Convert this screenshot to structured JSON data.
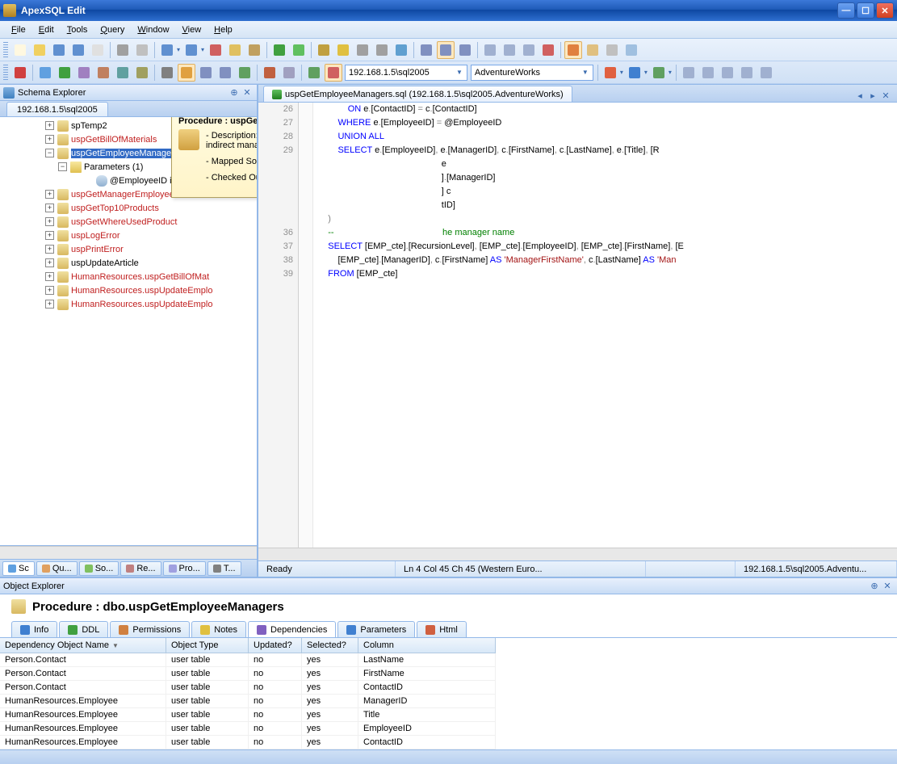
{
  "window": {
    "title": "ApexSQL Edit"
  },
  "menu": [
    "File",
    "Edit",
    "Tools",
    "Query",
    "Window",
    "View",
    "Help"
  ],
  "combos": {
    "server": "192.168.1.5\\sql2005",
    "database": "AdventureWorks"
  },
  "schemaExplorer": {
    "title": "Schema Explorer",
    "currentTab": "192.168.1.5\\sql2005",
    "nodes": [
      {
        "ind": 56,
        "exp": "+",
        "icon": "proc",
        "label": "spTemp2"
      },
      {
        "ind": 56,
        "exp": "+",
        "icon": "proc",
        "label": "uspGetBillOfMaterials",
        "red": true
      },
      {
        "ind": 56,
        "exp": "−",
        "icon": "proc",
        "label": "uspGetEmployeeManagers",
        "sel": true
      },
      {
        "ind": 72,
        "exp": "−",
        "icon": "folder",
        "label": "Parameters (1)"
      },
      {
        "ind": 104,
        "noexp": true,
        "icon": "param",
        "label": "@EmployeeID int"
      },
      {
        "ind": 56,
        "exp": "+",
        "icon": "proc",
        "label": "uspGetManagerEmployees",
        "red": true
      },
      {
        "ind": 56,
        "exp": "+",
        "icon": "proc",
        "label": "uspGetTop10Products",
        "red": true
      },
      {
        "ind": 56,
        "exp": "+",
        "icon": "proc",
        "label": "uspGetWhereUsedProduct",
        "red": true
      },
      {
        "ind": 56,
        "exp": "+",
        "icon": "proc",
        "label": "uspLogError",
        "red": true
      },
      {
        "ind": 56,
        "exp": "+",
        "icon": "proc",
        "label": "uspPrintError",
        "red": true
      },
      {
        "ind": 56,
        "exp": "+",
        "icon": "proc",
        "label": "uspUpdateArticle"
      },
      {
        "ind": 56,
        "exp": "+",
        "icon": "proc",
        "label": "HumanResources.uspGetBillOfMat",
        "red": true
      },
      {
        "ind": 56,
        "exp": "+",
        "icon": "proc",
        "label": "HumanResources.uspUpdateEmplo",
        "red": true
      },
      {
        "ind": 56,
        "exp": "+",
        "icon": "proc",
        "label": "HumanResources.uspUpdateEmplo",
        "red": true
      }
    ],
    "viewtabs": [
      {
        "label": "Sc",
        "color": "#60a0e0",
        "active": true
      },
      {
        "label": "Qu...",
        "color": "#e0a060"
      },
      {
        "label": "So...",
        "color": "#80c060"
      },
      {
        "label": "Re...",
        "color": "#c08080"
      },
      {
        "label": "Pro...",
        "color": "#a0a0e0"
      },
      {
        "label": "T...",
        "color": "#808080"
      }
    ]
  },
  "editor": {
    "tabTitle": "uspGetEmployeeManagers.sql (192.168.1.5\\sql2005.AdventureWorks)",
    "firstLine": 26,
    "lines": [
      {
        "html": "            <span class='kw'>ON</span> e<span class='gy'>.</span>[ContactID] <span class='gy'>=</span> c<span class='gy'>.</span>[ContactID]"
      },
      {
        "html": "        <span class='kw'>WHERE</span> e<span class='gy'>.</span>[EmployeeID] <span class='gy'>=</span> @EmployeeID"
      },
      {
        "html": "        <span class='kw'>UNION</span> <span class='kw'>ALL</span>"
      },
      {
        "html": "        <span class='kw'>SELECT</span> e<span class='gy'>.</span>[EmployeeID]<span class='gy'>,</span> e<span class='gy'>.</span>[ManagerID]<span class='gy'>,</span> c<span class='gy'>.</span>[FirstName]<span class='gy'>,</span> c<span class='gy'>.</span>[LastName]<span class='gy'>,</span> e<span class='gy'>.</span>[Title]<span class='gy'>,</span> [R"
      },
      {
        "html": "                                                  e"
      },
      {
        "html": "                                                  ]<span class='gy'>.</span>[ManagerID]"
      },
      {
        "html": "                                                  ] c"
      },
      {
        "html": "                                                  tID]"
      },
      {
        "html": "    <span class='gy'>)</span>"
      },
      {
        "html": "    <span class='cm'>--                                            he manager name</span>"
      },
      {
        "html": "    <span class='kw'>SELECT</span> [EMP_cte]<span class='gy'>.</span>[RecursionLevel]<span class='gy'>,</span> [EMP_cte]<span class='gy'>.</span>[EmployeeID]<span class='gy'>,</span> [EMP_cte]<span class='gy'>.</span>[FirstName]<span class='gy'>,</span> [E"
      },
      {
        "html": "        [EMP_cte]<span class='gy'>.</span>[ManagerID]<span class='gy'>,</span> c<span class='gy'>.</span>[FirstName] <span class='kw'>AS</span> <span class='st'>'ManagerFirstName'</span><span class='gy'>,</span> c<span class='gy'>.</span>[LastName] <span class='kw'>AS</span> <span class='st'>'Man</span>"
      },
      {
        "html": "    <span class='kw'>FROM</span> [EMP_cte]"
      }
    ],
    "visibleLineNumbers": [
      26,
      27,
      28,
      29,
      "",
      "",
      "",
      "",
      "",
      36,
      37,
      38,
      39
    ]
  },
  "tooltip": {
    "title": "Procedure : uspGetEmployeeManagers",
    "description": "- Description: Stored procedure using a recursive query to return the direct and indirect managers of the specified employee.",
    "mapped": "- Mapped Source Control Item: $:/Procs/uspGetEmployeeManagers.sql",
    "checkedOut": "- Checked Out: Yes"
  },
  "status": {
    "ready": "Ready",
    "pos": "Ln 4   Col 45   Ch 45 (Western Euro...",
    "conn": "192.168.1.5\\sql2005.Adventu..."
  },
  "objectExplorer": {
    "panelTitle": "Object Explorer",
    "title": "Procedure : dbo.uspGetEmployeeManagers",
    "tabs": [
      "Info",
      "DDL",
      "Permissions",
      "Notes",
      "Dependencies",
      "Parameters",
      "Html"
    ],
    "activeTab": 4,
    "columns": [
      "Dependency Object Name",
      "Object Type",
      "Updated?",
      "Selected?",
      "Column"
    ],
    "rows": [
      [
        "Person.Contact",
        "user table",
        "no",
        "yes",
        "LastName"
      ],
      [
        "Person.Contact",
        "user table",
        "no",
        "yes",
        "FirstName"
      ],
      [
        "Person.Contact",
        "user table",
        "no",
        "yes",
        "ContactID"
      ],
      [
        "HumanResources.Employee",
        "user table",
        "no",
        "yes",
        "ManagerID"
      ],
      [
        "HumanResources.Employee",
        "user table",
        "no",
        "yes",
        "Title"
      ],
      [
        "HumanResources.Employee",
        "user table",
        "no",
        "yes",
        "EmployeeID"
      ],
      [
        "HumanResources.Employee",
        "user table",
        "no",
        "yes",
        "ContactID"
      ]
    ]
  },
  "tabIconColors": [
    "#4080d0",
    "#40a040",
    "#d08040",
    "#e0c040",
    "#8060c0",
    "#4080d0",
    "#d06040"
  ]
}
